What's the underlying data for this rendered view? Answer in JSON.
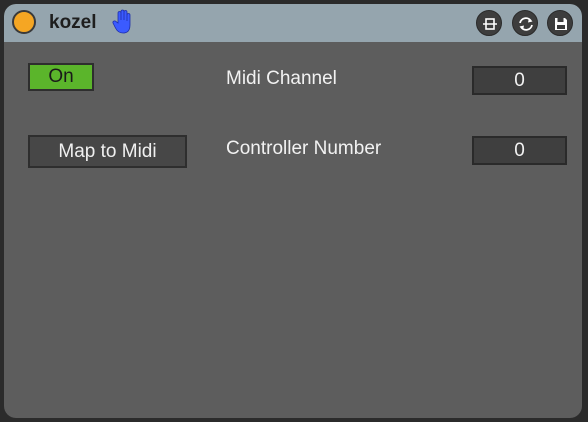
{
  "device": {
    "name": "kozel"
  },
  "titlebar": {
    "icons": [
      "power-icon",
      "hand-icon",
      "hotswap-icon",
      "replace-icon",
      "save-icon"
    ],
    "accent_color": "#f5a623",
    "background_color": "#95a5ae"
  },
  "controls": {
    "toggle_label": "On",
    "toggle_color": "#5bb52b",
    "map_button_label": "Map to Midi"
  },
  "params": {
    "midi_channel": {
      "label": "Midi Channel",
      "value": "0"
    },
    "controller_number": {
      "label": "Controller Number",
      "value": "0"
    }
  }
}
